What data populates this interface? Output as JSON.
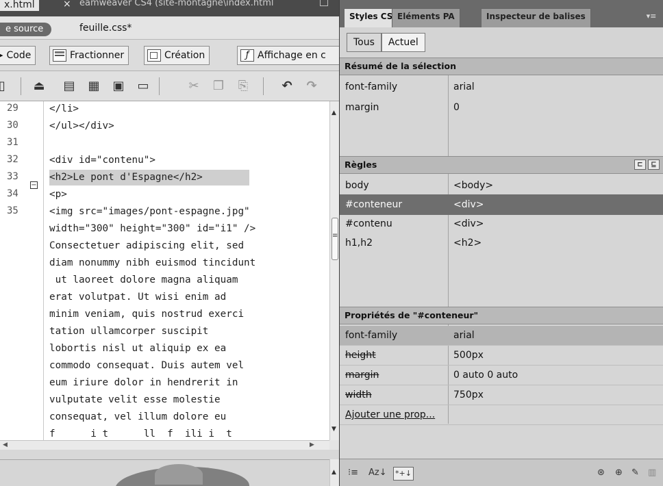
{
  "editor": {
    "doc_tab": "x.html",
    "doc_tab_close": "×",
    "doc_path": "eamweaver CS4 (site-montagne\\index.html",
    "related_source": "e source",
    "related_file": "feuille.css*",
    "view_buttons": {
      "code": "Code",
      "split": "Fractionner",
      "design": "Création",
      "live": "Affichage en c"
    },
    "toolbar_icons": [
      "partial-icon",
      "server-icon",
      "browse-icon",
      "file-management-icon",
      "save-icon",
      "print-icon",
      "cut-icon",
      "copy-icon",
      "paste-icon",
      "undo-icon",
      "redo-icon"
    ],
    "line_numbers": [
      "29",
      "30",
      "31",
      "32",
      "33",
      "34",
      "35"
    ],
    "code_lines": [
      "</li>",
      "</ul></div>",
      "",
      "<div id=\"contenu\">",
      "<h2>Le pont d'Espagne</h2>",
      "<p>",
      "<img src=\"images/pont-espagne.jpg\"",
      "width=\"300\" height=\"300\" id=\"i1\" />",
      "Consectetuer adipiscing elit, sed",
      "diam nonummy nibh euismod tincidunt",
      " ut laoreet dolore magna aliquam",
      "erat volutpat. Ut wisi enim ad",
      "minim veniam, quis nostrud exerci",
      "tation ullamcorper suscipit",
      "lobortis nisl ut aliquip ex ea",
      "commodo consequat. Duis autem vel",
      "eum iriure dolor in hendrerit in",
      "vulputate velit esse molestie",
      "consequat, vel illum dolore eu",
      "f      i t      ll  f  ili i  t"
    ]
  },
  "css_panel": {
    "tabs": [
      "Styles CSS",
      "Eléments PA",
      "Inspecteur de balises"
    ],
    "menu_icon": "▾≡",
    "modes": [
      "Tous",
      "Actuel"
    ],
    "summary": {
      "title": "Résumé de la sélection",
      "rows": [
        {
          "property": "font-family",
          "value": "arial"
        },
        {
          "property": "margin",
          "value": "0"
        }
      ]
    },
    "rules": {
      "title": "Règles",
      "rows": [
        {
          "selector": "body",
          "tag": "<body>"
        },
        {
          "selector": "#conteneur",
          "tag": "<div>"
        },
        {
          "selector": "#contenu",
          "tag": "<div>"
        },
        {
          "selector": "h1,h2",
          "tag": "<h2>"
        }
      ]
    },
    "properties": {
      "title": "Propriétés de \"#conteneur\"",
      "rows": [
        {
          "property": "font-family",
          "value": "arial"
        },
        {
          "property": "height",
          "value": "500px"
        },
        {
          "property": "margin",
          "value": "0 auto 0 auto"
        },
        {
          "property": "width",
          "value": "750px"
        }
      ],
      "add_link": "Ajouter une prop..."
    },
    "bottom": {
      "category_view": "⁝≡",
      "az_view": "Az↓",
      "set_only": "*+↓"
    }
  }
}
